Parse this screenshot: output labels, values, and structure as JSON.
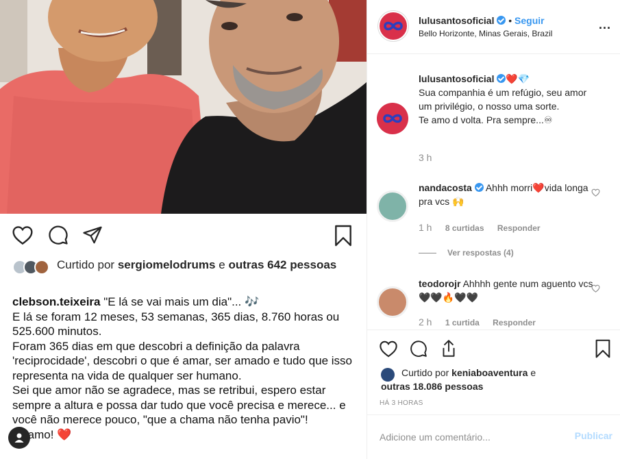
{
  "post": {
    "photo_alt": "",
    "likes": {
      "prefix": "Curtido por",
      "user": "sergiomelodrums",
      "conj": "e",
      "others": "outras 642",
      "suffix": "pessoas"
    },
    "caption": {
      "user": "clebson.teixeira",
      "line1": "\"E lá se vai mais um dia\"... 🎶",
      "paragraphs": [
        "E lá se foram 12 meses, 53 semanas, 365 dias, 8.760 horas ou 525.600 minutos.",
        "Foram 365 dias em que descobri a definição da palavra 'reciprocidade', descobri o que é amar, ser amado e tudo que isso representa na vida de qualquer ser humano.",
        "Sei que amor não se agradece, mas se retribui, espero estar sempre a altura e possa dar tudo que você precisa e merece... e você não merece pouco, \"que a chama não tenha pavio\"!",
        "Te amo! ❤️"
      ]
    },
    "icons": [
      "heart-icon",
      "comment-icon",
      "share-icon",
      "bookmark-icon"
    ]
  },
  "header": {
    "username": "lulusantosoficial",
    "separator": "•",
    "follow": "Seguir",
    "location": "Bello Horizonte, Minas Gerais, Brazil",
    "more": "..."
  },
  "comments": [
    {
      "user": "lulusantosoficial",
      "badge_emojis": "❤️💎",
      "text": "Sua companhia é um refúgio, seu amor um privilégio, o nosso uma sorte.",
      "text2": "Te amo d volta. Pra sempre...♾",
      "time": "3 h"
    },
    {
      "user": "nandacosta",
      "text": "Ahhh morri❤️vida longa pra vcs 🙌",
      "time": "1 h",
      "likes": "8 curtidas",
      "reply": "Responder",
      "view_replies": "Ver respostas (4)"
    },
    {
      "user": "teodorojr",
      "text": "Ahhhh gente num aguento vcs🖤🖤🔥🖤🖤",
      "time": "2 h",
      "likes": "1 curtida",
      "reply": "Responder"
    }
  ],
  "right_likes": {
    "prefix": "Curtido por",
    "user": "keniaboaventura",
    "conj": "e",
    "others": "outras 18.086 pessoas"
  },
  "right_time": "HÁ 3 HORAS",
  "comment_input": {
    "placeholder": "Adicione um comentário...",
    "publish": "Publicar"
  },
  "colors": {
    "accent": "#3897f0",
    "brand_avatar": "#d9304a",
    "publish_disabled": "#b3dbff"
  }
}
